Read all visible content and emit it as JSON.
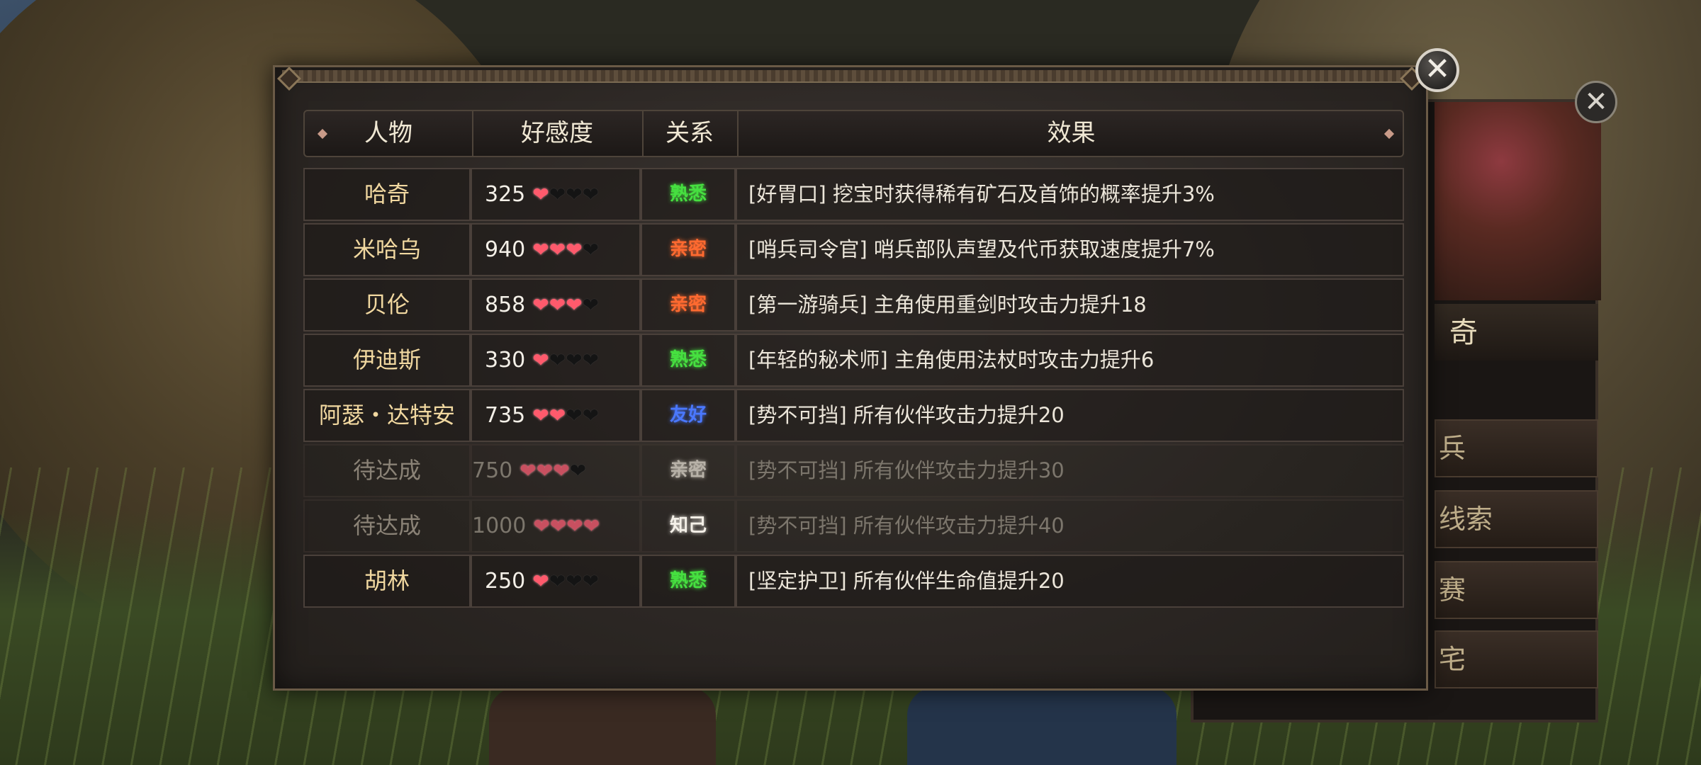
{
  "colors": {
    "name_gold": "#f1d8a0",
    "rel_familiar": "#46e040",
    "rel_intimate": "#ff6a30",
    "rel_friendly": "#4a78ff",
    "rel_pending": "#b8b2a8",
    "rel_soulmate": "#f4f0e8",
    "heart_on": "#ff5a6c"
  },
  "table": {
    "headers": {
      "character": "人物",
      "favor": "好感度",
      "relation": "关系",
      "effect": "效果"
    },
    "rows": [
      {
        "name": "哈奇",
        "favor": "325",
        "hearts": 1,
        "relation": "熟悉",
        "rel_color": "#46e040",
        "effect": "[好胃口] 挖宝时获得稀有矿石及首饰的概率提升3%",
        "pending": false
      },
      {
        "name": "米哈乌",
        "favor": "940",
        "hearts": 3,
        "relation": "亲密",
        "rel_color": "#ff6a30",
        "effect": "[哨兵司令官] 哨兵部队声望及代币获取速度提升7%",
        "pending": false
      },
      {
        "name": "贝伦",
        "favor": "858",
        "hearts": 3,
        "relation": "亲密",
        "rel_color": "#ff6a30",
        "effect": "[第一游骑兵] 主角使用重剑时攻击力提升18",
        "pending": false
      },
      {
        "name": "伊迪斯",
        "favor": "330",
        "hearts": 1,
        "relation": "熟悉",
        "rel_color": "#46e040",
        "effect": "[年轻的秘术师] 主角使用法杖时攻击力提升6",
        "pending": false
      },
      {
        "name": "阿瑟・达特安",
        "favor": "735",
        "hearts": 2,
        "relation": "友好",
        "rel_color": "#4a78ff",
        "effect": "[势不可挡] 所有伙伴攻击力提升20",
        "pending": false
      },
      {
        "name": "待达成",
        "favor": "750",
        "hearts": 3,
        "relation": "亲密",
        "rel_color": "#b8b2a8",
        "effect": "[势不可挡] 所有伙伴攻击力提升30",
        "pending": true
      },
      {
        "name": "待达成",
        "favor": "1000",
        "hearts": 4,
        "relation": "知己",
        "rel_color": "#f4f0e8",
        "effect": "[势不可挡] 所有伙伴攻击力提升40",
        "pending": true
      },
      {
        "name": "胡林",
        "favor": "250",
        "hearts": 1,
        "relation": "熟悉",
        "rel_color": "#46e040",
        "effect": "[坚定护卫] 所有伙伴生命值提升20",
        "pending": false
      }
    ]
  },
  "back_panel": {
    "name_fragment": "奇",
    "buttons": [
      "兵",
      "线索",
      "赛",
      "宅"
    ]
  },
  "icons": {
    "close": "close-icon",
    "heart": "heart-icon"
  }
}
